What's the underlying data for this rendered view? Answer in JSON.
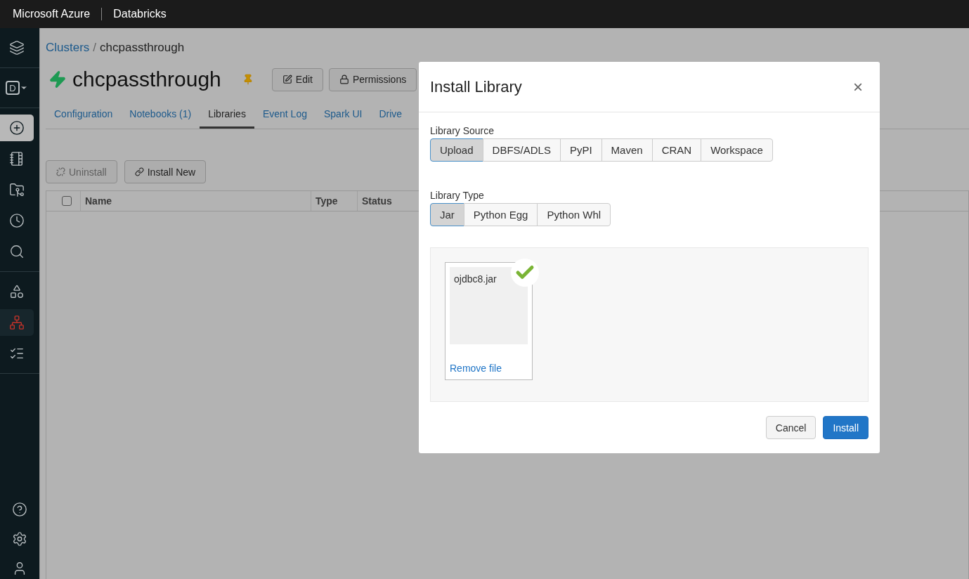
{
  "top_bar": {
    "brand": "Microsoft Azure",
    "product": "Databricks"
  },
  "sidebar": {
    "items": [
      {
        "selected": false
      },
      {
        "letter": "D",
        "selected": false
      },
      {
        "selected": false,
        "highlighted": true
      },
      {
        "selected": false
      },
      {
        "selected": false
      },
      {
        "selected": false
      },
      {
        "selected": false
      },
      {
        "selected": false
      },
      {
        "selected": true
      },
      {
        "selected": false
      }
    ]
  },
  "breadcrumb": {
    "link": "Clusters",
    "separator": "/",
    "current": "chcpassthrough"
  },
  "cluster": {
    "name": "chcpassthrough",
    "running": true,
    "pinned": true
  },
  "actions": [
    {
      "label": "Edit"
    },
    {
      "label": "Permissions"
    }
  ],
  "tabs": [
    {
      "label": "Configuration",
      "selected": false
    },
    {
      "label": "Notebooks (1)",
      "selected": false
    },
    {
      "label": "Libraries",
      "selected": true
    },
    {
      "label": "Event Log",
      "selected": false
    },
    {
      "label": "Spark UI",
      "selected": false
    },
    {
      "label": "Drive",
      "selected": false
    }
  ],
  "library_buttons": [
    {
      "label": "Uninstall",
      "disabled": true
    },
    {
      "label": "Install New",
      "disabled": false
    }
  ],
  "table": {
    "select_all_checked": false,
    "columns": [
      "Name",
      "Type",
      "Status"
    ]
  },
  "dialog": {
    "title": "Install Library",
    "close": "×",
    "source_label": "Library Source",
    "sources": [
      {
        "label": "Upload",
        "selected": true
      },
      {
        "label": "DBFS/ADLS",
        "selected": false
      },
      {
        "label": "PyPI",
        "selected": false
      },
      {
        "label": "Maven",
        "selected": false
      },
      {
        "label": "CRAN",
        "selected": false
      },
      {
        "label": "Workspace",
        "selected": false
      }
    ],
    "type_label": "Library Type",
    "types": [
      {
        "label": "Jar",
        "selected": true
      },
      {
        "label": "Python Egg",
        "selected": false
      },
      {
        "label": "Python Whl",
        "selected": false
      }
    ],
    "files": [
      {
        "name": "ojdbc8.jar",
        "uploaded": true,
        "remove": "Remove file"
      }
    ],
    "buttons": [
      {
        "label": "Cancel",
        "primary": false
      },
      {
        "label": "Install",
        "primary": true
      }
    ]
  }
}
